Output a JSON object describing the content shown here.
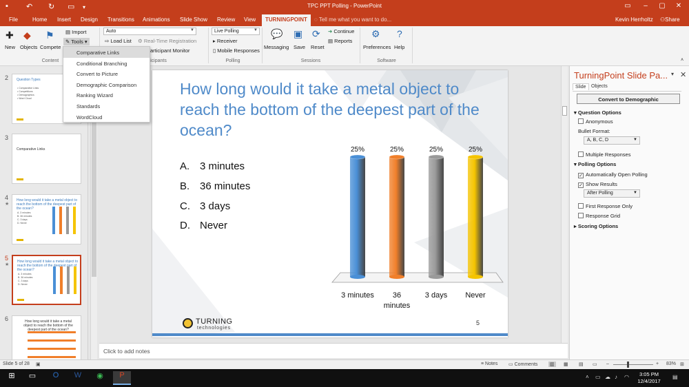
{
  "window": {
    "title": "TPC PPT Polling - PowerPoint",
    "user": "Kevin Herrholtz",
    "share": "Share",
    "tell_me": "Tell me what you want to do...",
    "controls": [
      "–",
      "▢",
      "✕"
    ],
    "ribbon_display_icon": "ribbon-display-icon"
  },
  "tabs": [
    "File",
    "Home",
    "Insert",
    "Design",
    "Transitions",
    "Animations",
    "Slide Show",
    "Review",
    "View",
    "TURNINGPOINT"
  ],
  "active_tab": "TURNINGPOINT",
  "ribbon": {
    "new": "New",
    "objects": "Objects",
    "competition": "Compete",
    "import": "Import",
    "tools": "Tools",
    "content_group": "Content",
    "auto_combo": "Auto",
    "load_list": "Load List",
    "real_time_registration": "Real-Time Registration",
    "participant_monitor": "articipant Monitor",
    "participants_group": "icipants",
    "live_polling_combo": "Live Polling",
    "receiver": "Receiver",
    "mobile_responses": "Mobile Responses",
    "polling_group": "Polling",
    "messaging": "Messaging",
    "save": "Save",
    "reset": "Reset",
    "continue": "Continue",
    "reports": "Reports",
    "sessions_group": "Sessions",
    "preferences": "Preferences",
    "help": "Help",
    "software_group": "Software"
  },
  "tools_menu": {
    "items": [
      "Comparative Links",
      "Conditional Branching",
      "Convert to Picture",
      "Demographic Comparison",
      "Ranking Wizard",
      "Standards",
      "WordCloud"
    ],
    "highlighted": "Comparative Links"
  },
  "thumbnails": [
    {
      "number": "2",
      "title": "Question Types",
      "lines": [
        "• Comparative Links",
        "• Competitions",
        "• Demographics",
        "• Word Cloud"
      ]
    },
    {
      "number": "3",
      "title": "Comparative Links"
    },
    {
      "number": "4",
      "title": "How long would it take a metal object to reach the bottom of the deepest part of the ocean?",
      "star": "★",
      "answers": [
        "A.  3 minutes",
        "B.  36 minutes",
        "C.  3 days",
        "D.  Never"
      ]
    },
    {
      "number": "5",
      "title": "How long would it take a metal object to reach the bottom of the deepest part of the ocean?",
      "star": "★",
      "answers": [
        "A.  3 minutes",
        "B.  36 minutes",
        "C.  3 days",
        "D.  Never"
      ],
      "selected": true
    },
    {
      "number": "6",
      "title": "How long would it take a metal object to reach the bottom of the deepest part of the ocean?"
    }
  ],
  "slide": {
    "title": "How long would it take a metal object to reach the bottom of the deepest part of the ocean?",
    "answers": [
      {
        "letter": "A.",
        "text": "3 minutes"
      },
      {
        "letter": "B.",
        "text": "36 minutes"
      },
      {
        "letter": "C.",
        "text": "3 days"
      },
      {
        "letter": "D.",
        "text": "Never"
      }
    ],
    "logo_word": "TURNING",
    "logo_sub": "technologies",
    "number": "5"
  },
  "chart_data": {
    "type": "bar",
    "categories": [
      "3 minutes",
      "36 minutes",
      "3 days",
      "Never"
    ],
    "category_label_lines": [
      [
        "3 minutes"
      ],
      [
        "36",
        "minutes"
      ],
      [
        "3 days"
      ],
      [
        "Never"
      ]
    ],
    "values": [
      25,
      25,
      25,
      25
    ],
    "value_labels": [
      "25%",
      "25%",
      "25%",
      "25%"
    ],
    "colors": [
      "#4a8fd6",
      "#f07f2a",
      "#9a9a9a",
      "#f5c400"
    ],
    "ylim": [
      0,
      25
    ],
    "grid": false,
    "title": "",
    "xlabel": "",
    "ylabel": ""
  },
  "notes": {
    "placeholder": "Click to add notes"
  },
  "task_pane": {
    "title": "TurningPoint Slide Pa...",
    "tabs": [
      "Slide",
      "Objects"
    ],
    "convert_button": "Convert to Demographic",
    "question_options": "Question Options",
    "anonymous": "Anonymous",
    "bullet_format_label": "Bullet Format:",
    "bullet_format_value": "A, B, C, D",
    "multiple_responses": "Multiple Responses",
    "polling_options": "Polling Options",
    "auto_open_polling": "Automatically Open Polling",
    "show_results": "Show Results",
    "show_results_value": "After Polling",
    "first_response_only": "First Response Only",
    "response_grid": "Response Grid",
    "scoring_options": "Scoring Options",
    "checked": {
      "anonymous": false,
      "multiple_responses": false,
      "auto_open_polling": true,
      "show_results": true,
      "first_response_only": false,
      "response_grid": false
    }
  },
  "status": {
    "slide_of": "Slide 5 of 28",
    "notes": "Notes",
    "comments": "Comments",
    "zoom": "83%"
  },
  "taskbar": {
    "time": "3:05 PM",
    "date": "12/4/2017"
  }
}
